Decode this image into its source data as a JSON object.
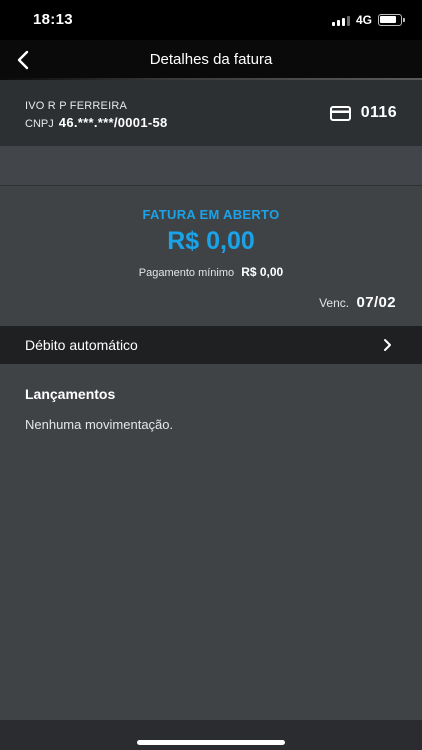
{
  "status_bar": {
    "time": "18:13",
    "network": "4G",
    "icons": [
      "signal-icon",
      "battery-icon"
    ]
  },
  "nav": {
    "title": "Detalhes da fatura",
    "back_icon": "chevron-left-icon"
  },
  "account": {
    "holder_name": "IVO R P FERREIRA",
    "cnpj_label": "CNPJ",
    "cnpj_value": "46.***.***/0001-58",
    "card_icon": "credit-card-icon",
    "card_number": "0116"
  },
  "invoice": {
    "status": "FATURA EM ABERTO",
    "total": "R$ 0,00",
    "minimum_label": "Pagamento mínimo",
    "minimum_value": "R$ 0,00",
    "due_label": "Venc.",
    "due_date": "07/02"
  },
  "autodebit": {
    "label": "Débito automático",
    "icon": "chevron-right-icon"
  },
  "transactions": {
    "title": "Lançamentos",
    "empty_message": "Nenhuma movimentação."
  },
  "colors": {
    "accent": "#1aa3e8",
    "background": "#3f4346",
    "header": "#0a0a0a",
    "panel": "#2d3033",
    "row": "#1e2022"
  }
}
